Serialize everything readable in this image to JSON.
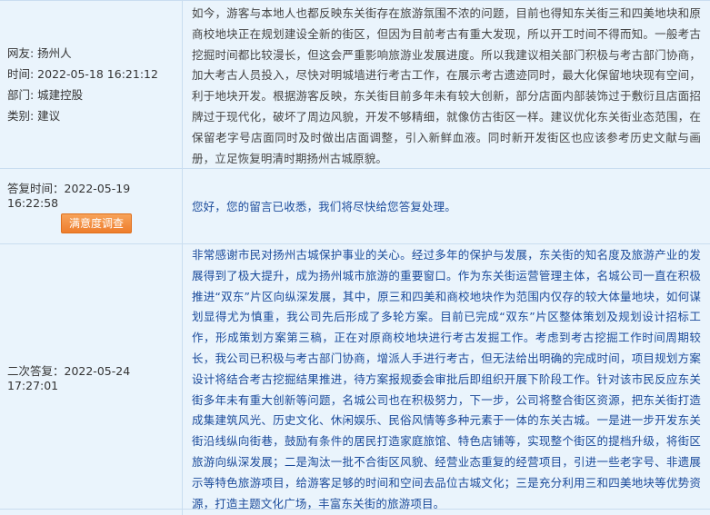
{
  "message": {
    "user_label": "网友: 扬州人",
    "time_label": "时间: 2022-05-18 16:21:12",
    "department_label": "部门: 城建控股",
    "category_label": "类别: 建议",
    "content": "如今，游客与本地人也都反映东关街存在旅游氛围不浓的问题，目前也得知东关街三和四美地块和原商校地块正在规划建设全新的街区，但因为目前考古有重大发现，所以开工时间不得而知。一般考古挖掘时间都比较漫长，但这会严重影响旅游业发展进度。所以我建议相关部门积极与考古部门协商，加大考古人员投入，尽快对明城墙进行考古工作，在展示考古遗迹同时，最大化保留地块现有空间，利于地块开发。根据游客反映，东关街目前多年未有较大创新，部分店面内部装饰过于敷衍且店面招牌过于现代化，破坏了周边风貌，开发不够精细，就像仿古街区一样。建议优化东关街业态范围，在保留老字号店面同时及时做出店面调整，引入新鲜血液。同时新开发街区也应该参考历史文献与画册，立足恢复明清时期扬州古城原貌。"
  },
  "reply1": {
    "time_label": "答复时间：2022-05-19 16:22:58",
    "survey_button": "满意度调查",
    "content": "您好，您的留言已收悉，我们将尽快给您答复处理。"
  },
  "reply2": {
    "time_label": "二次答复：2022-05-24 17:27:01",
    "content": "非常感谢市民对扬州古城保护事业的关心。经过多年的保护与发展，东关街的知名度及旅游产业的发展得到了极大提升，成为扬州城市旅游的重要窗口。作为东关街运营管理主体，名城公司一直在积极推进“双东”片区向纵深发展，其中，原三和四美和商校地块作为范围内仅存的较大体量地块，如何谋划显得尤为慎重，我公司先后形成了多轮方案。目前已完成“双东”片区整体策划及规划设计招标工作，形成策划方案第三稿，正在对原商校地块进行考古发掘工作。考虑到考古挖掘工作时间周期较长，我公司已积极与考古部门协商，增派人手进行考古，但无法给出明确的完成时间，项目规划方案设计将结合考古挖掘结果推进，待方案报规委会审批后即组织开展下阶段工作。针对该市民反应东关街多年未有重大创新等问题，名城公司也在积极努力，下一步，公司将整合街区资源，把东关街打造成集建筑风光、历史文化、休闲娱乐、民俗风情等多种元素于一体的东关古城。一是进一步开发东关街沿线纵向街巷，鼓励有条件的居民打造家庭旅馆、特色店铺等，实现整个街区的提档升级，将街区旅游向纵深发展；二是淘汰一批不合街区风貌、经营业态重复的经营项目，引进一些老字号、非遗展示等特色旅游项目，给游客足够的时间和空间去品位古城文化；三是充分利用三和四美地块等优势资源，打造主题文化广场，丰富东关街的旅游项目。"
  }
}
